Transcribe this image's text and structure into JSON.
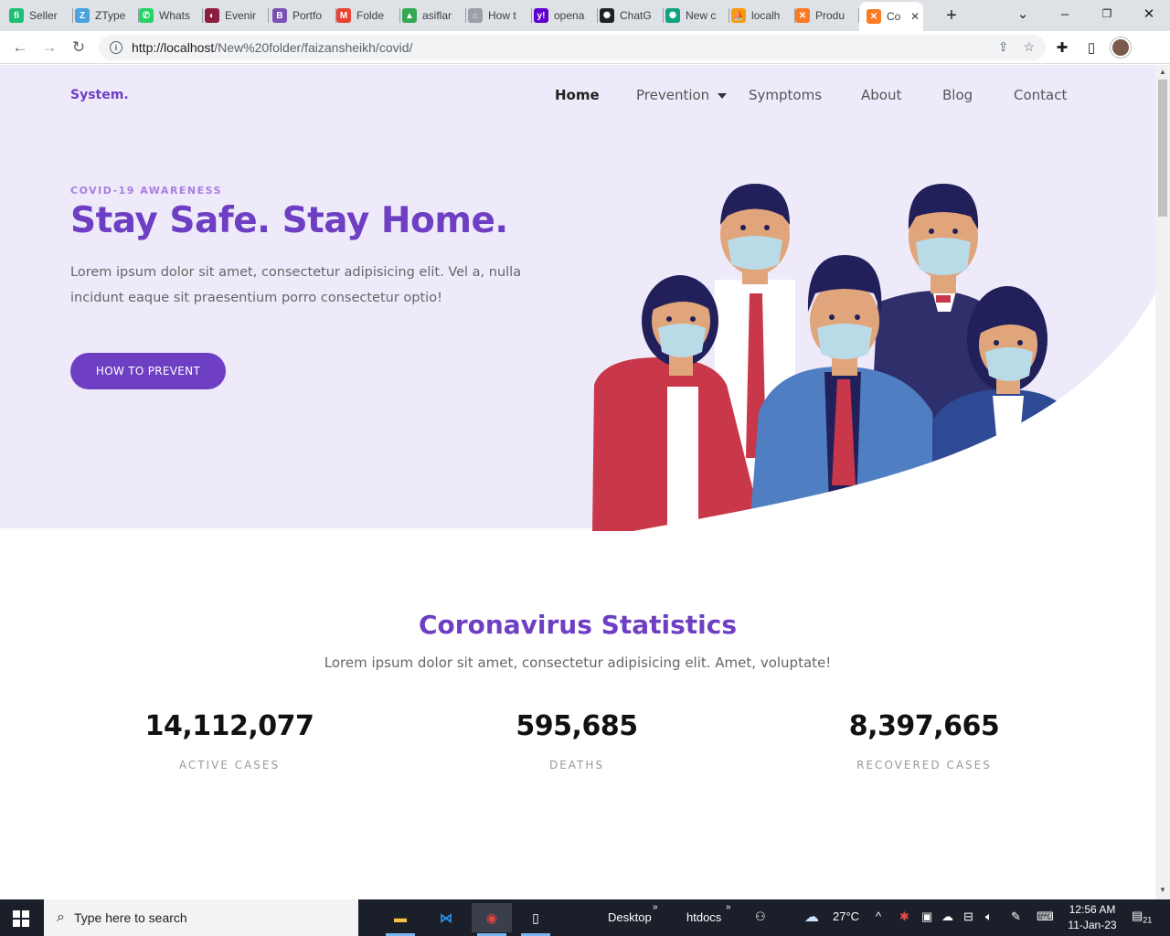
{
  "browser": {
    "tabs": [
      {
        "label": "Seller",
        "icon": "fiverr-icon",
        "color": "#1dbf73",
        "glyph": "fi"
      },
      {
        "label": "ZType",
        "icon": "ztype-icon",
        "color": "#4aa3df",
        "glyph": "Z"
      },
      {
        "label": "Whats",
        "icon": "whatsapp-icon",
        "color": "#25d366",
        "glyph": "✆"
      },
      {
        "label": "Evenir",
        "icon": "evening-icon",
        "color": "#8b1e3f",
        "glyph": "◐"
      },
      {
        "label": "Portfo",
        "icon": "bootstrap-icon",
        "color": "#7952b3",
        "glyph": "B"
      },
      {
        "label": "Folde",
        "icon": "gmail-icon",
        "color": "#ea4335",
        "glyph": "M"
      },
      {
        "label": "asiflar",
        "icon": "drive-icon",
        "color": "#34a853",
        "glyph": "▲"
      },
      {
        "label": "How t",
        "icon": "home-icon",
        "color": "#9aa0a6",
        "glyph": "⌂"
      },
      {
        "label": "opena",
        "icon": "yahoo-icon",
        "color": "#6001d2",
        "glyph": "y!"
      },
      {
        "label": "ChatG",
        "icon": "openai-icon",
        "color": "#202124",
        "glyph": "✺"
      },
      {
        "label": "New c",
        "icon": "chatgpt-icon",
        "color": "#10a37f",
        "glyph": "✺"
      },
      {
        "label": "localh",
        "icon": "phpmyadmin-icon",
        "color": "#f89c0e",
        "glyph": "⛵"
      },
      {
        "label": "Produ",
        "icon": "xampp-icon",
        "color": "#fb7a24",
        "glyph": "✕"
      },
      {
        "label": "Co",
        "icon": "xampp-icon",
        "color": "#fb7a24",
        "glyph": "✕"
      }
    ],
    "new_tab": "+",
    "url_host": "http://localhost",
    "url_path": "/New%20folder/faizansheikh/covid/"
  },
  "site": {
    "logo": "System.",
    "nav": {
      "home": "Home",
      "prevention": "Prevention",
      "symptoms": "Symptoms",
      "about": "About",
      "blog": "Blog",
      "contact": "Contact"
    },
    "hero": {
      "kicker": "COVID-19 AWARENESS",
      "headline": "Stay Safe. Stay Home.",
      "lead": "Lorem ipsum dolor sit amet, consectetur adipisicing elit. Vel a, nulla incidunt eaque sit praesentium porro consectetur optio!",
      "cta": "HOW TO PREVENT"
    },
    "stats": {
      "title": "Coronavirus Statistics",
      "subtitle": "Lorem ipsum dolor sit amet, consectetur adipisicing elit. Amet, voluptate!",
      "items": [
        {
          "value": "14,112,077",
          "label": "ACTIVE CASES"
        },
        {
          "value": "595,685",
          "label": "DEATHS"
        },
        {
          "value": "8,397,665",
          "label": "RECOVERED CASES"
        }
      ]
    },
    "colors": {
      "accent": "#6e3fc3",
      "hero_bg": "#efeafa"
    }
  },
  "taskbar": {
    "search_placeholder": "Type here to search",
    "desktop": "Desktop",
    "htdocs": "htdocs",
    "temperature": "27°C",
    "time": "12:56 AM",
    "date": "11-Jan-23",
    "notification_count": "21"
  }
}
